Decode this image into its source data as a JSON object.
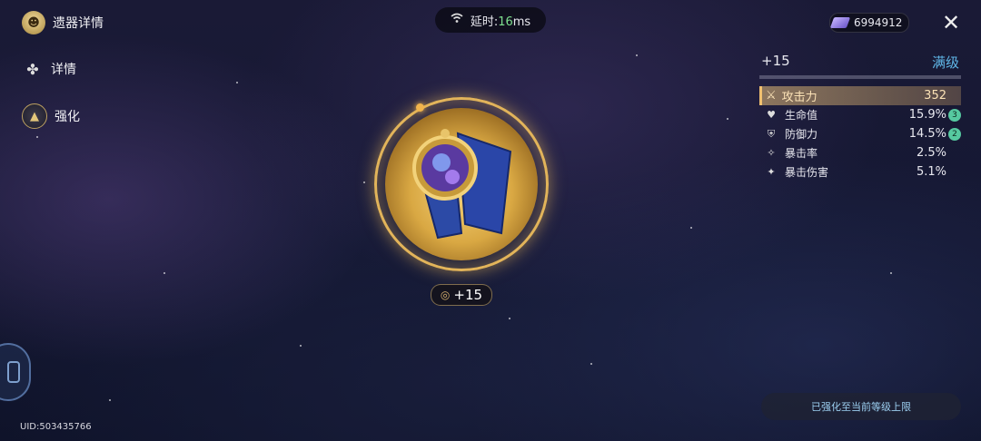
{
  "sidebar": {
    "title": "遗器详情",
    "items": [
      {
        "label": "详情"
      },
      {
        "label": "强化"
      }
    ]
  },
  "uid": "UID:503435766",
  "latency": {
    "label": "延时:",
    "value": "16",
    "unit": "ms"
  },
  "currency": {
    "amount": "6994912"
  },
  "stats": {
    "level": "+15",
    "level_status": "满级",
    "main_stat": {
      "name": "攻击力",
      "value": "352"
    },
    "sub_stats": [
      {
        "icon": "heart-icon",
        "name": "生命值",
        "value": "15.9%",
        "rolls": "3"
      },
      {
        "icon": "shield-icon",
        "name": "防御力",
        "value": "14.5%",
        "rolls": "2"
      },
      {
        "icon": "crit-rate-icon",
        "name": "暴击率",
        "value": "2.5%",
        "rolls": ""
      },
      {
        "icon": "crit-dmg-icon",
        "name": "暴击伤害",
        "value": "5.1%",
        "rolls": ""
      }
    ]
  },
  "relic": {
    "level_badge": "+15"
  },
  "status_button": {
    "label": "已强化至当前等级上限"
  },
  "colors": {
    "accent_gold": "#e2b45a",
    "max_level_blue": "#5fb6e6",
    "roll_badge_green": "#56c9a0",
    "latency_green": "#7ee08f"
  }
}
